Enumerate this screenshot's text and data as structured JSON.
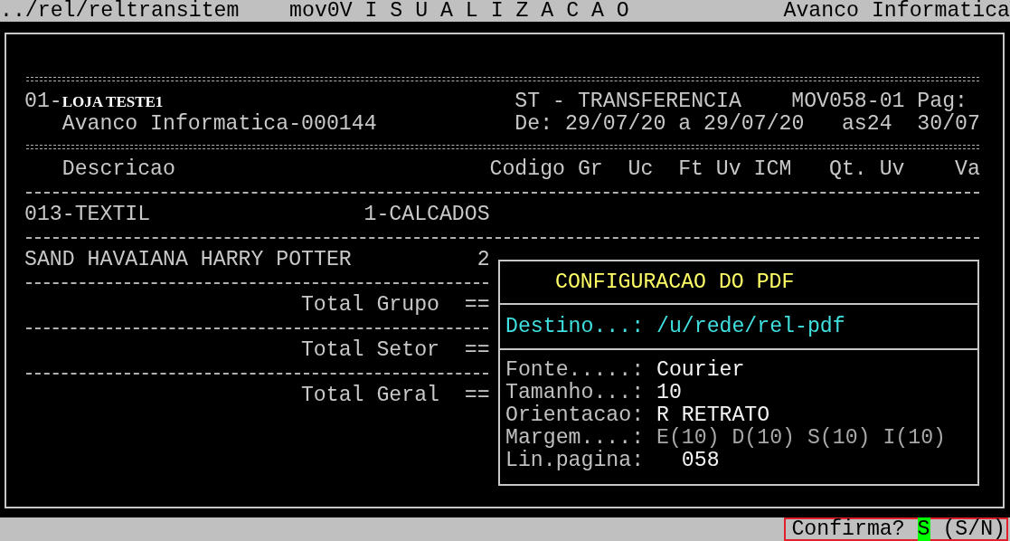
{
  "top_bar": {
    "path": "../rel/reltransitem",
    "program": "mov0V I S U A L I Z A C A O",
    "company": "Avanco Informatica"
  },
  "report": {
    "header": {
      "store_code": "01-",
      "store_name": "LOJA TESTE1",
      "report_type": "ST - TRANSFERENCIA",
      "report_id": "MOV058-01",
      "page_label": "Pag:",
      "company": "Avanco Informatica-000144",
      "period": "De: 29/07/20 a 29/07/20",
      "user": "as24",
      "date": "30/07"
    },
    "columns": [
      "Descricao",
      "Codigo",
      "Gr",
      "Uc",
      "Ft",
      "Uv",
      "ICM",
      "Qt.",
      "Uv",
      "Va"
    ],
    "group": {
      "sector": "013-TEXTIL",
      "group": "1-CALCADOS"
    },
    "items": [
      {
        "description": "SAND HAVAIANA HARRY POTTER",
        "code": "2"
      }
    ],
    "totals": [
      "Total Grupo  ==",
      "Total Setor  ==",
      "Total Geral  =="
    ]
  },
  "dialog": {
    "title": "CONFIGURACAO DO PDF",
    "destination_label": "Destino...:",
    "destination": "/u/rede/rel-pdf",
    "fields": [
      {
        "label": "Fonte.....:",
        "value": "Courier",
        "bright": true,
        "kind": "text"
      },
      {
        "label": "Tamanho...:",
        "value": "10",
        "bright": true,
        "kind": "text"
      },
      {
        "label": "Orientacao:",
        "value": "R RETRATO",
        "bright": true,
        "kind": "text"
      },
      {
        "label": "Margem....:",
        "value": "E(10) D(10) S(10) I(10)",
        "bright": false,
        "kind": "text"
      },
      {
        "label": "Lin.pagina:",
        "value": "058",
        "bright": true,
        "kind": "number"
      }
    ]
  },
  "status_bar": {
    "prompt": "Confirma?",
    "value": "S",
    "options": "(S/N)"
  }
}
